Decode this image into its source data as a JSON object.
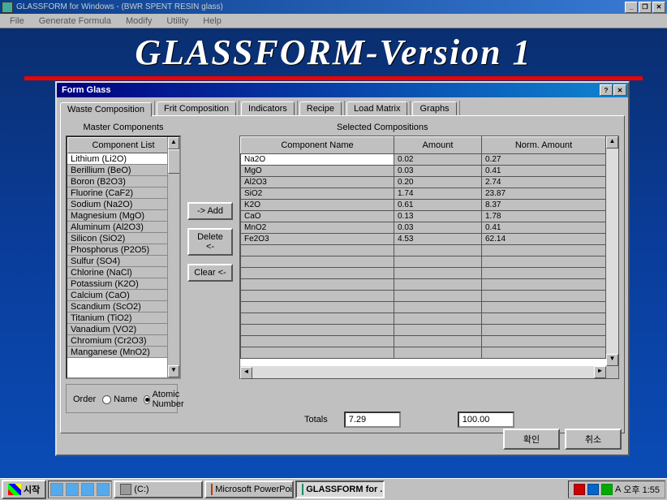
{
  "titlebar": {
    "text": "GLASSFORM for Windows - (BWR SPENT RESIN glass)"
  },
  "menubar": [
    "File",
    "Generate Formula",
    "Modify",
    "Utility",
    "Help"
  ],
  "app_title": "GLASSFORM-Version 1",
  "dialog": {
    "title": "Form Glass",
    "tabs": [
      "Waste Composition",
      "Frit Composition",
      "Indicators",
      "Recipe",
      "Load Matrix",
      "Graphs"
    ],
    "active_tab": 0,
    "master_label": "Master Components",
    "selected_label": "Selected Compositions",
    "list_header": "Component List",
    "components": [
      "Lithium (Li2O)",
      "Berillium (BeO)",
      "Boron (B2O3)",
      "Fluorine (CaF2)",
      "Sodium (Na2O)",
      "Magnesium (MgO)",
      "Aluminum (Al2O3)",
      "Silicon (SiO2)",
      "Phosphorus (P2O5)",
      "Sulfur (SO4)",
      "Chlorine (NaCl)",
      "Potassium (K2O)",
      "Calcium (CaO)",
      "Scandium (ScO2)",
      "Titanium (TiO2)",
      "Vanadium (VO2)",
      "Chromium (Cr2O3)",
      "Manganese (MnO2)"
    ],
    "buttons": {
      "add": "-> Add",
      "delete": "Delete <-",
      "clear": "Clear <-"
    },
    "grid_headers": [
      "Component Name",
      "Amount",
      "Norm. Amount"
    ],
    "grid_rows": [
      {
        "name": "Na2O",
        "amount": "0.02",
        "norm": "0.27"
      },
      {
        "name": "MgO",
        "amount": "0.03",
        "norm": "0.41"
      },
      {
        "name": "Al2O3",
        "amount": "0.20",
        "norm": "2.74"
      },
      {
        "name": "SiO2",
        "amount": "1.74",
        "norm": "23.87"
      },
      {
        "name": "K2O",
        "amount": "0.61",
        "norm": "8.37"
      },
      {
        "name": "CaO",
        "amount": "0.13",
        "norm": "1.78"
      },
      {
        "name": "MnO2",
        "amount": "0.03",
        "norm": "0.41"
      },
      {
        "name": "Fe2O3",
        "amount": "4.53",
        "norm": "62.14"
      }
    ],
    "empty_rows": 10,
    "order": {
      "legend": "Order",
      "opt_name": "Name",
      "opt_atomic": "Atomic Number",
      "selected": "atomic"
    },
    "totals": {
      "label": "Totals",
      "amount": "7.29",
      "norm": "100.00"
    },
    "ok": "확인",
    "cancel": "취소"
  },
  "taskbar": {
    "start": "시작",
    "drive": "(C:)",
    "tasks": [
      {
        "label": "Microsoft PowerPoint ...",
        "active": false
      },
      {
        "label": "GLASSFORM for ...",
        "active": true
      }
    ],
    "clock": "오후 1:55"
  }
}
